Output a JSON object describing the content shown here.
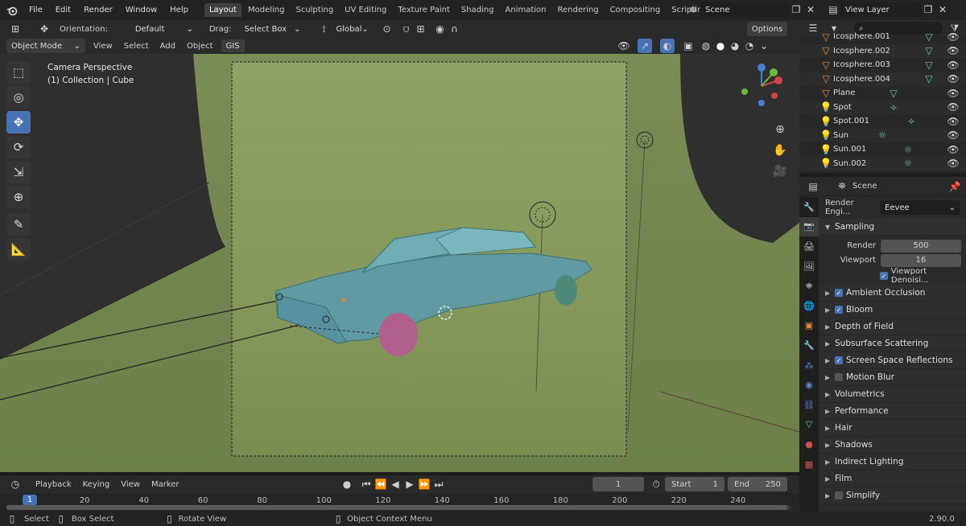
{
  "topbar": {
    "menus": [
      "File",
      "Edit",
      "Render",
      "Window",
      "Help"
    ],
    "workspaces": [
      "Layout",
      "Modeling",
      "Sculpting",
      "UV Editing",
      "Texture Paint",
      "Shading",
      "Animation",
      "Rendering",
      "Compositing",
      "Scripting"
    ],
    "active_workspace": "Layout",
    "add_tab": "+",
    "scene_name": "Scene",
    "view_layer": "View Layer"
  },
  "viewport_header": {
    "orientation_label": "Orientation:",
    "orientation_value": "Default",
    "drag_label": "Drag:",
    "drag_value": "Select Box",
    "transform_space": "Global",
    "options": "Options",
    "mode": "Object Mode",
    "menus": [
      "View",
      "Select",
      "Add",
      "Object",
      "GIS"
    ]
  },
  "viewport": {
    "camera_text": "Camera Perspective",
    "collection_text": "(1) Collection | Cube",
    "gizmo_axes": [
      "X",
      "Y",
      "Z"
    ]
  },
  "outliner": {
    "items": [
      {
        "name": "Icosphere.001",
        "icon": "mesh-icon",
        "color": "#e08a3a"
      },
      {
        "name": "Icosphere.002",
        "icon": "mesh-icon",
        "color": "#e08a3a"
      },
      {
        "name": "Icosphere.003",
        "icon": "mesh-icon",
        "color": "#e08a3a"
      },
      {
        "name": "Icosphere.004",
        "icon": "mesh-icon",
        "color": "#e08a3a"
      },
      {
        "name": "Plane",
        "icon": "mesh-icon",
        "color": "#e08a3a"
      },
      {
        "name": "Spot",
        "icon": "light-icon",
        "color": "#e08a3a"
      },
      {
        "name": "Spot.001",
        "icon": "light-icon",
        "color": "#e08a3a"
      },
      {
        "name": "Sun",
        "icon": "light-icon",
        "color": "#e08a3a"
      },
      {
        "name": "Sun.001",
        "icon": "light-icon",
        "color": "#e08a3a"
      },
      {
        "name": "Sun.002",
        "icon": "light-icon",
        "color": "#e08a3a"
      }
    ]
  },
  "properties": {
    "context": "Scene",
    "render_engine_label": "Render Engi...",
    "render_engine_value": "Eevee",
    "sampling": {
      "title": "Sampling",
      "render_label": "Render",
      "render_value": "500",
      "viewport_label": "Viewport",
      "viewport_value": "16",
      "denoise_label": "Viewport Denoisi..."
    },
    "panels": [
      {
        "label": "Ambient Occlusion",
        "checkbox": true,
        "checked": true
      },
      {
        "label": "Bloom",
        "checkbox": true,
        "checked": true
      },
      {
        "label": "Depth of Field",
        "checkbox": false
      },
      {
        "label": "Subsurface Scattering",
        "checkbox": false
      },
      {
        "label": "Screen Space Reflections",
        "checkbox": true,
        "checked": true
      },
      {
        "label": "Motion Blur",
        "checkbox": true,
        "checked": false
      },
      {
        "label": "Volumetrics",
        "checkbox": false
      },
      {
        "label": "Performance",
        "checkbox": false
      },
      {
        "label": "Hair",
        "checkbox": false
      },
      {
        "label": "Shadows",
        "checkbox": false
      },
      {
        "label": "Indirect Lighting",
        "checkbox": false
      },
      {
        "label": "Film",
        "checkbox": false
      },
      {
        "label": "Simplify",
        "checkbox": true,
        "checked": false
      }
    ]
  },
  "timeline": {
    "menus": [
      "Playback",
      "Keying",
      "View",
      "Marker"
    ],
    "current_frame": "1",
    "start_label": "Start",
    "start_value": "1",
    "end_label": "End",
    "end_value": "250",
    "ticks": [
      "20",
      "40",
      "60",
      "80",
      "100",
      "120",
      "140",
      "160",
      "180",
      "200",
      "220",
      "240"
    ],
    "playhead": "1"
  },
  "statusbar": {
    "select": "Select",
    "box_select": "Box Select",
    "rotate_view": "Rotate View",
    "context_menu": "Object Context Menu",
    "version": "2.90.0"
  },
  "colors": {
    "accent": "#4772b3",
    "camera_frame": "#8a9a66",
    "car_body": "#6aa8b0",
    "wheel_pink": "#b0608a"
  }
}
